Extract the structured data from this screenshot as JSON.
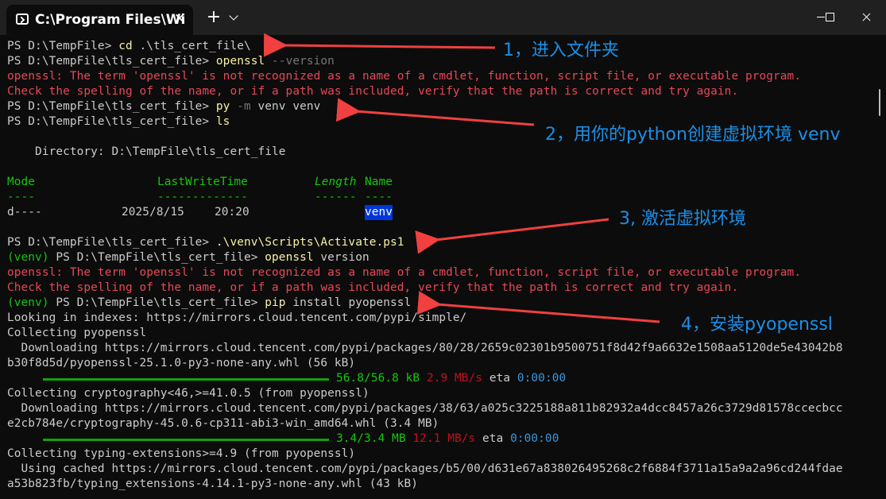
{
  "window": {
    "tab_title": "C:\\Program Files\\Wi",
    "tab_close": "✕",
    "new_tab": "+",
    "icons": {
      "terminal": "terminal-icon",
      "dropdown": "chevron-down-icon",
      "minimize": "minimize-icon",
      "maximize": "maximize-icon",
      "close": "close-icon"
    }
  },
  "terminal": {
    "l1": {
      "prompt": "PS D:\\TempFile> ",
      "cmd": "cd",
      "arg": " .\\tls_cert_file\\"
    },
    "l2": {
      "prompt": "PS D:\\TempFile\\tls_cert_file> ",
      "cmd": "openssl",
      "arg": " --version"
    },
    "err1a": "openssl: The term 'openssl' is not recognized as a name of a cmdlet, function, script file, or executable program.",
    "err1b": "Check the spelling of the name, or if a path was included, verify that the path is correct and try again.",
    "l5": {
      "prompt": "PS D:\\TempFile\\tls_cert_file> ",
      "cmd": "py",
      "flag": " -m",
      "arg": " venv venv"
    },
    "l6": {
      "prompt": "PS D:\\TempFile\\tls_cert_file> ",
      "cmd": "ls"
    },
    "directory": "    Directory: D:\\TempFile\\tls_cert_file",
    "table": {
      "headers": [
        "Mode",
        "LastWriteTime",
        "Length",
        "Name"
      ],
      "dashes": [
        "----",
        "-------------",
        "------",
        "----"
      ],
      "row": {
        "mode": "d----",
        "date": "2025/8/15",
        "time": "20:20",
        "name": "venv"
      }
    },
    "l11": {
      "prompt": "PS D:\\TempFile\\tls_cert_file> ",
      "cmd": ".\\venv\\Scripts\\Activate.ps1"
    },
    "l12": {
      "env": "(venv) ",
      "prompt": "PS D:\\TempFile\\tls_cert_file> ",
      "cmd": "openssl",
      "arg": " version"
    },
    "err2a": "openssl: The term 'openssl' is not recognized as a name of a cmdlet, function, script file, or executable program.",
    "err2b": "Check the spelling of the name, or if a path was included, verify that the path is correct and try again.",
    "l15": {
      "env": "(venv) ",
      "prompt": "PS D:\\TempFile\\tls_cert_file> ",
      "cmd": "pip",
      "arg": " install pyopenssl"
    },
    "pip": {
      "indexes": "Looking in indexes: https://mirrors.cloud.tencent.com/pypi/simple/",
      "collect1": "Collecting pyopenssl",
      "dl1a": "  Downloading https://mirrors.cloud.tencent.com/pypi/packages/80/28/2659c02301b9500751f8d42f9a6632e1508aa5120de5e43042b8",
      "dl1b": "b30f8d5d/pyopenssl-25.1.0-py3-none-any.whl (56 kB)",
      "p1": {
        "size": "56.8/56.8 kB",
        "rate": "2.9 MB/s",
        "eta_label": "eta",
        "eta": "0:00:00",
        "progress": 1.0
      },
      "collect2": "Collecting cryptography<46,>=41.0.5 (from pyopenssl)",
      "dl2a": "  Downloading https://mirrors.cloud.tencent.com/pypi/packages/38/63/a025c3225188a811b82932a4dcc8457a26c3729d81578ccecbcc",
      "dl2b": "e2cb784e/cryptography-45.0.6-cp311-abi3-win_amd64.whl (3.4 MB)",
      "p2": {
        "size": "3.4/3.4 MB",
        "rate": "12.1 MB/s",
        "eta_label": "eta",
        "eta": "0:00:00",
        "progress": 1.0
      },
      "collect3": "Collecting typing-extensions>=4.9 (from pyopenssl)",
      "cache_a": "  Using cached https://mirrors.cloud.tencent.com/pypi/packages/b5/00/d631e67a838026495268c2f6884f3711a15a9a2a96cd244fdae",
      "cache_b": "a53b823fb/typing_extensions-4.14.1-py3-none-any.whl (43 kB)"
    }
  },
  "annotations": {
    "a1": "1，进入文件夹",
    "a2": "2，用你的python创建虚拟环境 venv",
    "a3": "3, 激活虚拟环境",
    "a4": "4，安装pyopenssl",
    "color": "#1b8fe8",
    "arrow_color": "#f04040"
  }
}
